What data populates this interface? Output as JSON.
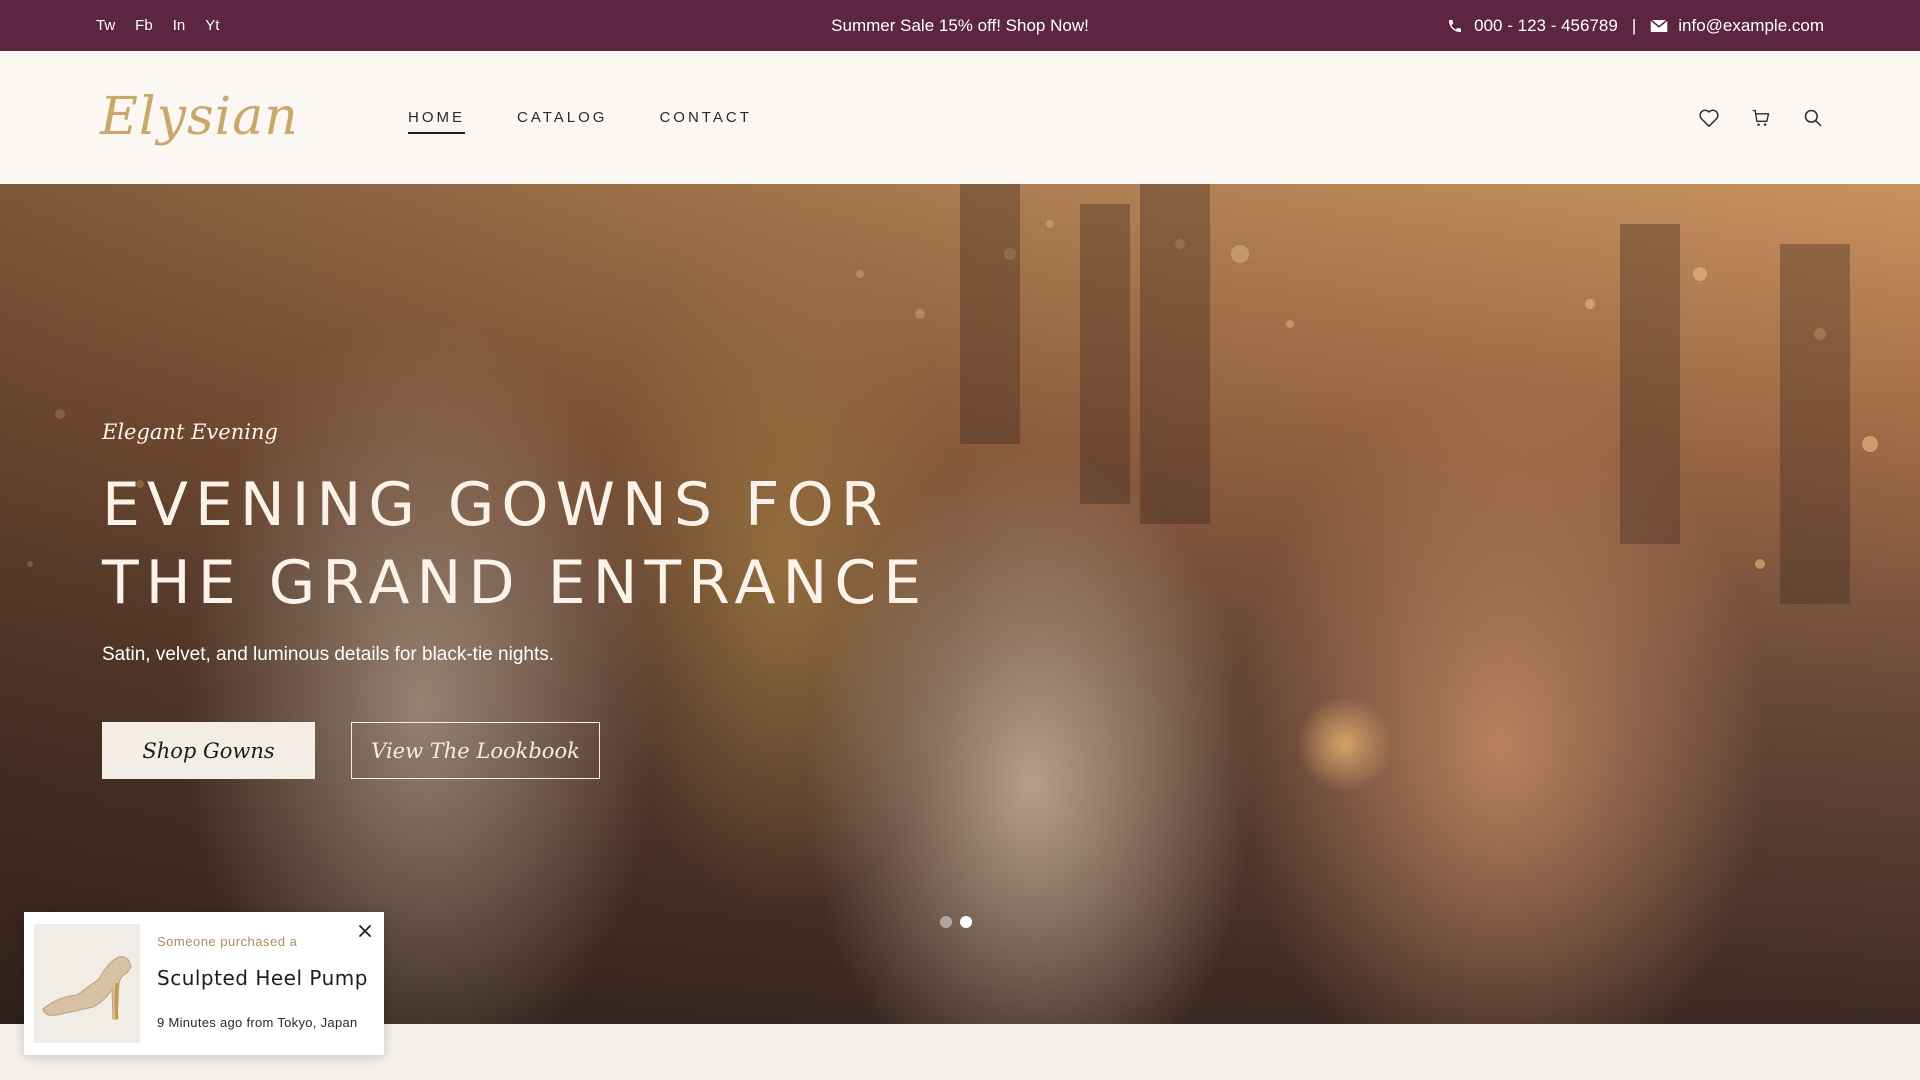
{
  "topbar": {
    "socials": [
      "Tw",
      "Fb",
      "In",
      "Yt"
    ],
    "promo": "Summer Sale 15% off! Shop Now!",
    "phone": "000 - 123 - 456789",
    "separator": "|",
    "email": "info@example.com",
    "icons": {
      "phone": "phone-icon",
      "email": "mail-icon"
    }
  },
  "header": {
    "logo": "Elysian",
    "nav": [
      {
        "label": "HOME",
        "active": true
      },
      {
        "label": "CATALOG",
        "active": false
      },
      {
        "label": "CONTACT",
        "active": false
      }
    ],
    "icons": [
      "heart-icon",
      "cart-icon",
      "search-icon"
    ]
  },
  "hero": {
    "eyebrow": "Elegant Evening",
    "title_line1": "EVENING GOWNS FOR",
    "title_line2": "THE GRAND ENTRANCE",
    "subtitle": "Satin, velvet, and luminous details for black-tie nights.",
    "primary_button": "Shop Gowns",
    "secondary_button": "View The Lookbook",
    "slides": {
      "count": 2,
      "active": 2
    }
  },
  "toast": {
    "eyebrow": "Someone purchased a",
    "product": "Sculpted Heel Pump",
    "meta": "9 Minutes ago from Tokyo, Japan"
  },
  "colors": {
    "topbar_bg": "#5c2540",
    "logo_gold": "#c9a86a",
    "header_bg": "#fbf8f4",
    "page_bg": "#f4efea"
  }
}
